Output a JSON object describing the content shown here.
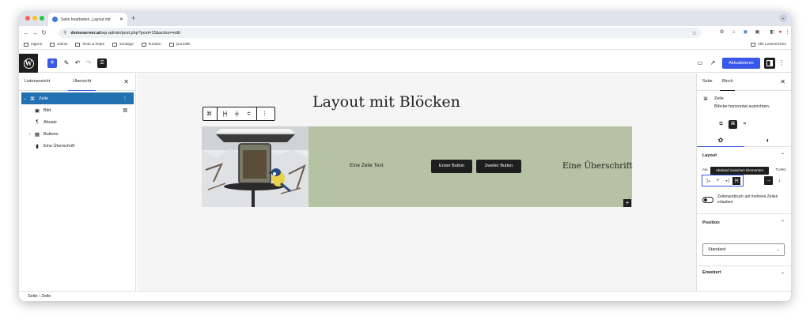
{
  "browser": {
    "tab_title": "Seite bearbeiten „Layout mit",
    "tab_close": "✕",
    "new_tab": "+",
    "url_host": "demoserver.at",
    "url_path": "/wp-admin/post.php?post=15&action=edit",
    "bookmarks": [
      "eigene",
      "admin",
      "hints & helps",
      "sonstige",
      "kunden",
      "journalle"
    ],
    "bookmarks_right": "Alle Lesezeichen"
  },
  "editor": {
    "update_label": "Aktualisieren",
    "left_tabs": {
      "list": "Listenansicht",
      "overview": "Übersicht"
    },
    "list_items": [
      {
        "label": "Zeile",
        "icon": "⌘",
        "chevron": "⌄"
      },
      {
        "label": "Bild",
        "icon": "▣",
        "chevron": ""
      },
      {
        "label": "Absatz",
        "icon": "¶",
        "chevron": ""
      },
      {
        "label": "Buttons",
        "icon": "▦",
        "chevron": "›"
      },
      {
        "label": "Eine Überschrift",
        "icon": "▮",
        "chevron": ""
      }
    ],
    "canvas": {
      "heading": "Layout mit Blöcken",
      "paragraph": "Eine Zeile Text",
      "button1": "Erster Button",
      "button2": "Zweiter Button",
      "group_heading": "Eine Überschrift",
      "group_bg": "#b5c3a4"
    },
    "right_tabs": {
      "page": "Seite",
      "block": "Block"
    },
    "block_name": "Zeile",
    "block_desc": "Blöcke horizontal ausrichten.",
    "layout_title": "Layout",
    "justify_label_left": "AN",
    "justify_label_right": "TUNG",
    "tooltip": "Abstand zwischen Elementen",
    "wrap_label": "Zeilenumbruch auf mehrere Zeilen erlauben",
    "position_title": "Position",
    "position_value": "Standard",
    "advanced_title": "Erweitert",
    "breadcrumb": "Seite  ›  Zeile",
    "accent": "#3858e9"
  }
}
